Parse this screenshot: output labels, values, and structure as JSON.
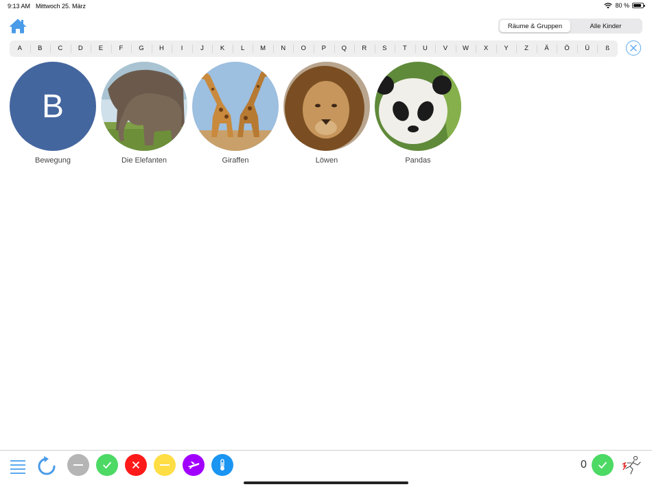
{
  "status_bar": {
    "time": "9:13 AM",
    "date": "Mittwoch 25. März",
    "battery": "80 %"
  },
  "segment": {
    "options": [
      "Räume & Gruppen",
      "Alle Kinder"
    ],
    "selected": "Räume & Gruppen"
  },
  "alphabet": [
    "A",
    "B",
    "C",
    "D",
    "E",
    "F",
    "G",
    "H",
    "I",
    "J",
    "K",
    "L",
    "M",
    "N",
    "O",
    "P",
    "Q",
    "R",
    "S",
    "T",
    "U",
    "V",
    "W",
    "X",
    "Y",
    "Z",
    "Ä",
    "Ö",
    "Ü",
    "ß"
  ],
  "groups": [
    {
      "name": "Bewegung",
      "initial": "B"
    },
    {
      "name": "Die Elefanten",
      "image": "elephants-photo"
    },
    {
      "name": "Giraffen",
      "image": "giraffes-photo"
    },
    {
      "name": "Löwen",
      "image": "lion-photo"
    },
    {
      "name": "Pandas",
      "image": "panda-photo"
    }
  ],
  "bottom_bar": {
    "count": "0",
    "status_buttons": [
      {
        "icon": "minus-icon",
        "color": "#b5b5b5"
      },
      {
        "icon": "check-icon",
        "color": "#4cd964"
      },
      {
        "icon": "cross-icon",
        "color": "#ff1a1a"
      },
      {
        "icon": "minus-icon",
        "color": "#ffdd44"
      },
      {
        "icon": "airplane-icon",
        "color": "#a100ff"
      },
      {
        "icon": "thermometer-icon",
        "color": "#1a95f2"
      }
    ]
  },
  "colors": {
    "accent": "#5aa9f0",
    "group_initial_bg": "#44669f"
  }
}
